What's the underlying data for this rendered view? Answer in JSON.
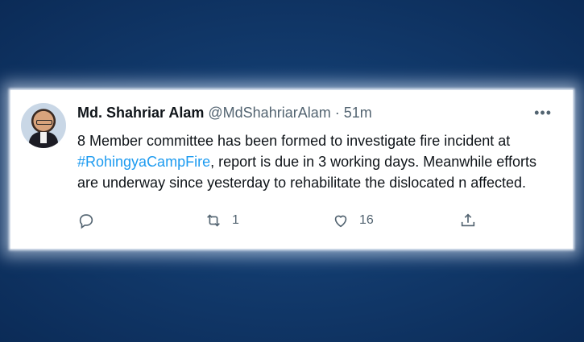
{
  "tweet": {
    "author_name": "Md. Shahriar Alam",
    "handle": "@MdShahriarAlam",
    "separator": "·",
    "time": "51m",
    "more": "•••",
    "text_before": "8 Member committee has been formed to investigate fire incident at ",
    "hashtag": "#RohingyaCampFire",
    "text_after": ", report is due in 3 working days. Meanwhile efforts are underway since yesterday to rehabilitate the dislocated n affected.",
    "actions": {
      "reply_count": "",
      "retweet_count": "1",
      "like_count": "16"
    }
  },
  "icons": [
    "reply-icon",
    "retweet-icon",
    "like-icon",
    "share-icon",
    "more-icon"
  ],
  "colors": {
    "background": "#0b2b57",
    "link": "#1d9bf0",
    "text": "#0f1419",
    "muted": "#536471"
  }
}
